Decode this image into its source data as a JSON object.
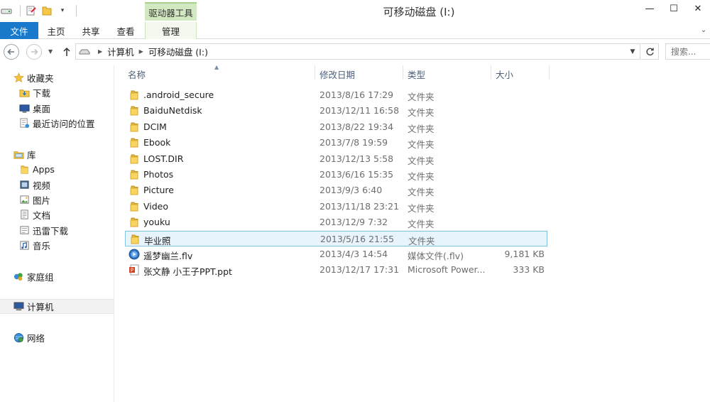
{
  "window": {
    "title": "可移动磁盘 (I:)",
    "contextual_tools": "驱动器工具",
    "controls": {
      "minimize": "—",
      "maximize": "☐",
      "close": "✕"
    }
  },
  "ribbon": {
    "tabs": [
      {
        "label": "文件",
        "active": true
      },
      {
        "label": "主页"
      },
      {
        "label": "共享"
      },
      {
        "label": "查看"
      },
      {
        "label": "管理"
      }
    ],
    "expand_glyph": "⌄"
  },
  "addressbar": {
    "breadcrumbs": [
      "计算机",
      "可移动磁盘 (I:)"
    ],
    "search_placeholder": "搜索..."
  },
  "navpane": {
    "favorites": {
      "label": "收藏夹",
      "items": [
        "下载",
        "桌面",
        "最近访问的位置"
      ]
    },
    "libraries": {
      "label": "库",
      "items": [
        "Apps",
        "视频",
        "图片",
        "文档",
        "迅雷下载",
        "音乐"
      ]
    },
    "homegroup": "家庭组",
    "computer": "计算机",
    "network": "网络"
  },
  "columns": {
    "name": "名称",
    "date": "修改日期",
    "type": "类型",
    "size": "大小"
  },
  "files": [
    {
      "name": ".android_secure",
      "date": "2013/8/16 17:29",
      "type": "文件夹",
      "size": "",
      "icon": "folder-icon"
    },
    {
      "name": "BaiduNetdisk",
      "date": "2013/12/11 16:58",
      "type": "文件夹",
      "size": "",
      "icon": "folder-icon"
    },
    {
      "name": "DCIM",
      "date": "2013/8/22 19:34",
      "type": "文件夹",
      "size": "",
      "icon": "folder-icon"
    },
    {
      "name": "Ebook",
      "date": "2013/7/8 19:59",
      "type": "文件夹",
      "size": "",
      "icon": "folder-icon"
    },
    {
      "name": "LOST.DIR",
      "date": "2013/12/13 5:58",
      "type": "文件夹",
      "size": "",
      "icon": "folder-icon"
    },
    {
      "name": "Photos",
      "date": "2013/6/16 15:35",
      "type": "文件夹",
      "size": "",
      "icon": "folder-icon"
    },
    {
      "name": "Picture",
      "date": "2013/9/3 6:40",
      "type": "文件夹",
      "size": "",
      "icon": "folder-icon"
    },
    {
      "name": "Video",
      "date": "2013/11/18 23:21",
      "type": "文件夹",
      "size": "",
      "icon": "folder-icon"
    },
    {
      "name": "youku",
      "date": "2013/12/9 7:32",
      "type": "文件夹",
      "size": "",
      "icon": "folder-icon"
    },
    {
      "name": "毕业照",
      "date": "2013/5/16 21:55",
      "type": "文件夹",
      "size": "",
      "icon": "folder-icon",
      "selected": true
    },
    {
      "name": "遥梦幽兰.flv",
      "date": "2013/4/3 14:54",
      "type": "媒体文件(.flv)",
      "size": "9,181 KB",
      "icon": "media-file-icon"
    },
    {
      "name": "张文静 小王子PPT.ppt",
      "date": "2013/12/17 17:31",
      "type": "Microsoft Power...",
      "size": "333 KB",
      "icon": "ppt-file-icon"
    }
  ],
  "colors": {
    "file_tab": "#1979ca",
    "tools_tab": "#d2e8c0",
    "selection": "#e8f4fb",
    "selection_border": "#84c3e6",
    "header_text": "#4c607a"
  }
}
